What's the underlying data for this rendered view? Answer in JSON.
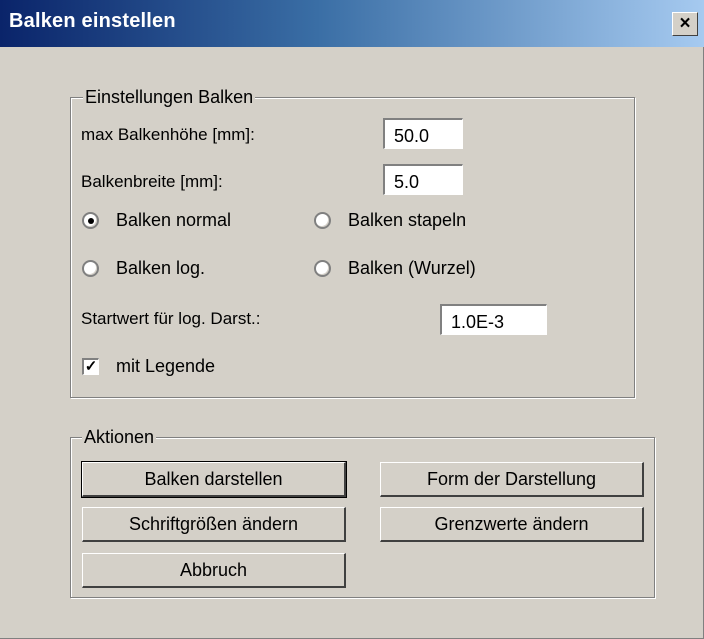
{
  "window": {
    "title": "Balken einstellen",
    "close_label": "×"
  },
  "settings": {
    "legend": "Einstellungen Balken",
    "max_height_label": "max Balkenhöhe [mm]:",
    "max_height_value": "50.0",
    "width_label": "Balkenbreite  [mm]:",
    "width_value": "5.0",
    "radios": [
      {
        "label": "Balken  normal",
        "checked": true
      },
      {
        "label": "Balken  stapeln",
        "checked": false
      },
      {
        "label": "Balken log.",
        "checked": false
      },
      {
        "label": "Balken (Wurzel)",
        "checked": false
      }
    ],
    "start_label": "Startwert für log. Darst.:",
    "start_value": "1.0E-3",
    "legend_checkbox": {
      "label": "mit Legende",
      "checked": true
    }
  },
  "actions": {
    "legend": "Aktionen",
    "show_bars": "Balken darstellen",
    "form": "Form der Darstellung",
    "font_sizes": "Schriftgrößen ändern",
    "limits": "Grenzwerte ändern",
    "cancel": "Abbruch"
  }
}
